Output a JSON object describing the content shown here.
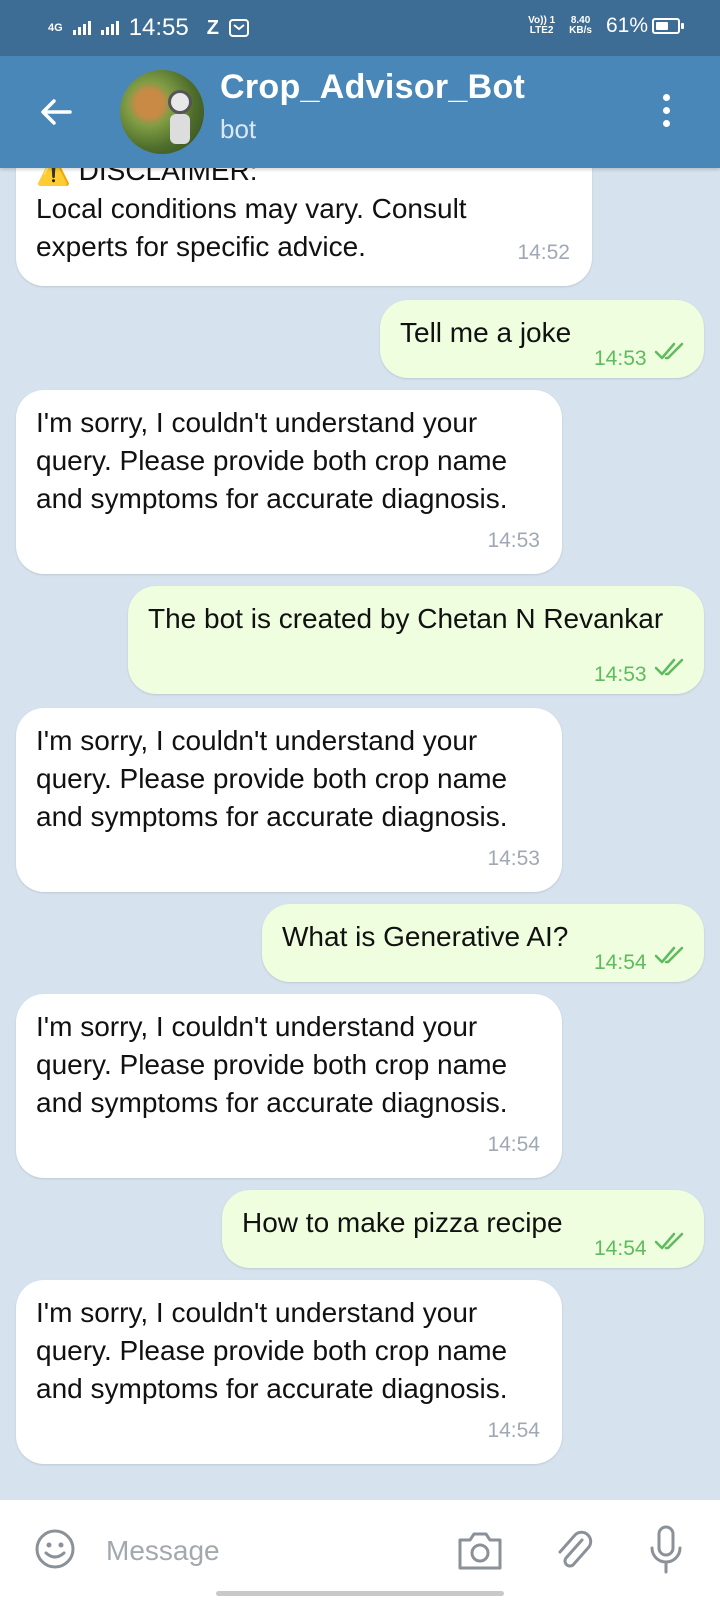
{
  "status_bar": {
    "network": "4G",
    "time": "14:55",
    "app_letter": "Z",
    "volte": "Vo)) 1\nLTE2",
    "speed": "8.40\nKB/s",
    "battery_percent": "61%",
    "battery_level": 0.61
  },
  "header": {
    "title": "Crop_Advisor_Bot",
    "subtitle": "bot",
    "back_icon": "arrow-left-icon",
    "menu_icon": "more-vertical-icon"
  },
  "messages": [
    {
      "direction": "in",
      "text": "⚠️ DISCLAIMER:\n  Local conditions may vary. Consult\nexperts for specific advice.",
      "time": "14:52"
    },
    {
      "direction": "out",
      "text": "Tell me a joke",
      "time": "14:53",
      "read": true
    },
    {
      "direction": "in",
      "text": "I'm sorry, I couldn't understand your\nquery. Please provide both crop name\nand symptoms for accurate diagnosis.",
      "time": "14:53"
    },
    {
      "direction": "out",
      "text": "The bot is created by Chetan N Revankar",
      "time": "14:53",
      "read": true
    },
    {
      "direction": "in",
      "text": "I'm sorry, I couldn't understand your\nquery. Please provide both crop name\nand symptoms for accurate diagnosis.",
      "time": "14:53"
    },
    {
      "direction": "out",
      "text": "What is Generative AI?",
      "time": "14:54",
      "read": true
    },
    {
      "direction": "in",
      "text": "I'm sorry, I couldn't understand your\nquery. Please provide both crop name\nand symptoms for accurate diagnosis.",
      "time": "14:54"
    },
    {
      "direction": "out",
      "text": "How to make pizza recipe",
      "time": "14:54",
      "read": true
    },
    {
      "direction": "in",
      "text": "I'm sorry, I couldn't understand your\nquery. Please provide both crop name\nand symptoms for accurate diagnosis.",
      "time": "14:54"
    }
  ],
  "input": {
    "placeholder": "Message",
    "emoji_icon": "emoji-icon",
    "camera_icon": "camera-icon",
    "attach_icon": "paperclip-icon",
    "mic_icon": "microphone-icon"
  },
  "colors": {
    "header": "#4a87b9",
    "status_bar": "#3d6d95",
    "chat_bg": "#d6e3ee",
    "outgoing_bubble": "#eefedf",
    "incoming_bubble": "#ffffff",
    "read_time": "#5fbb5d"
  }
}
